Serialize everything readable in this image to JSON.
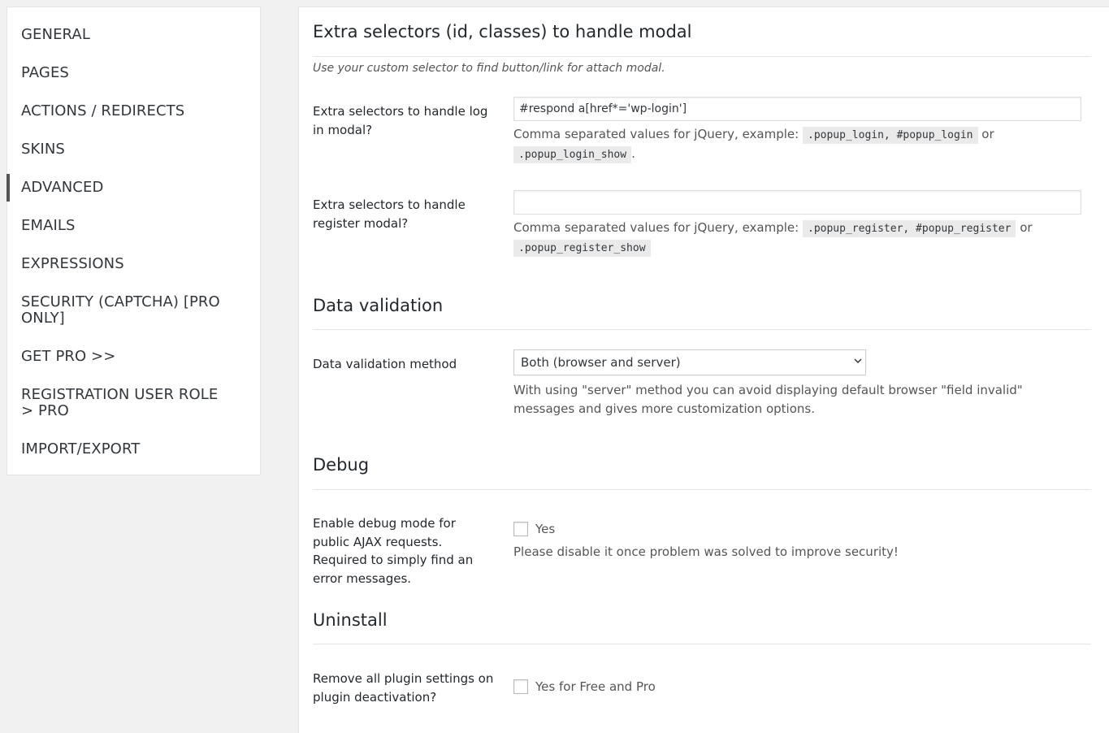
{
  "sidebar": {
    "items": [
      {
        "label": "GENERAL"
      },
      {
        "label": "PAGES"
      },
      {
        "label": "ACTIONS / REDIRECTS"
      },
      {
        "label": "SKINS"
      },
      {
        "label": "ADVANCED",
        "active": true
      },
      {
        "label": "EMAILS"
      },
      {
        "label": "EXPRESSIONS"
      },
      {
        "label": "SECURITY (CAPTCHA) [PRO ONLY]"
      },
      {
        "label": "GET PRO >>"
      },
      {
        "label": "REGISTRATION USER ROLE > PRO"
      },
      {
        "label": "IMPORT/EXPORT"
      }
    ]
  },
  "extra_selectors": {
    "title": "Extra selectors (id, classes) to handle modal",
    "description": "Use your custom selector to find button/link for attach modal.",
    "login": {
      "label": "Extra selectors to handle log in modal?",
      "value": "#respond a[href*='wp-login']",
      "help_prefix": "Comma separated values for jQuery, example:",
      "code_1": ".popup_login, #popup_login",
      "help_or": "or",
      "code_2": ".popup_login_show",
      "help_suffix": "."
    },
    "register": {
      "label": "Extra selectors to handle register modal?",
      "value": "",
      "help_prefix": "Comma separated values for jQuery, example:",
      "code_1": ".popup_register, #popup_register",
      "help_or": "or",
      "code_2": ".popup_register_show"
    }
  },
  "data_validation": {
    "title": "Data validation",
    "method_label": "Data validation method",
    "selected": "Both (browser and server)",
    "help": "With using \"server\" method you can avoid displaying default browser \"field invalid\" messages and gives more customization options."
  },
  "debug": {
    "title": "Debug",
    "label": "Enable debug mode for public AJAX requests. Required to simply find an error messages.",
    "checkbox_label": "Yes",
    "checked": false,
    "help": "Please disable it once problem was solved to improve security!"
  },
  "uninstall": {
    "title": "Uninstall",
    "label": "Remove all plugin settings on plugin deactivation?",
    "checkbox_label": "Yes for Free and Pro",
    "checked": false
  }
}
